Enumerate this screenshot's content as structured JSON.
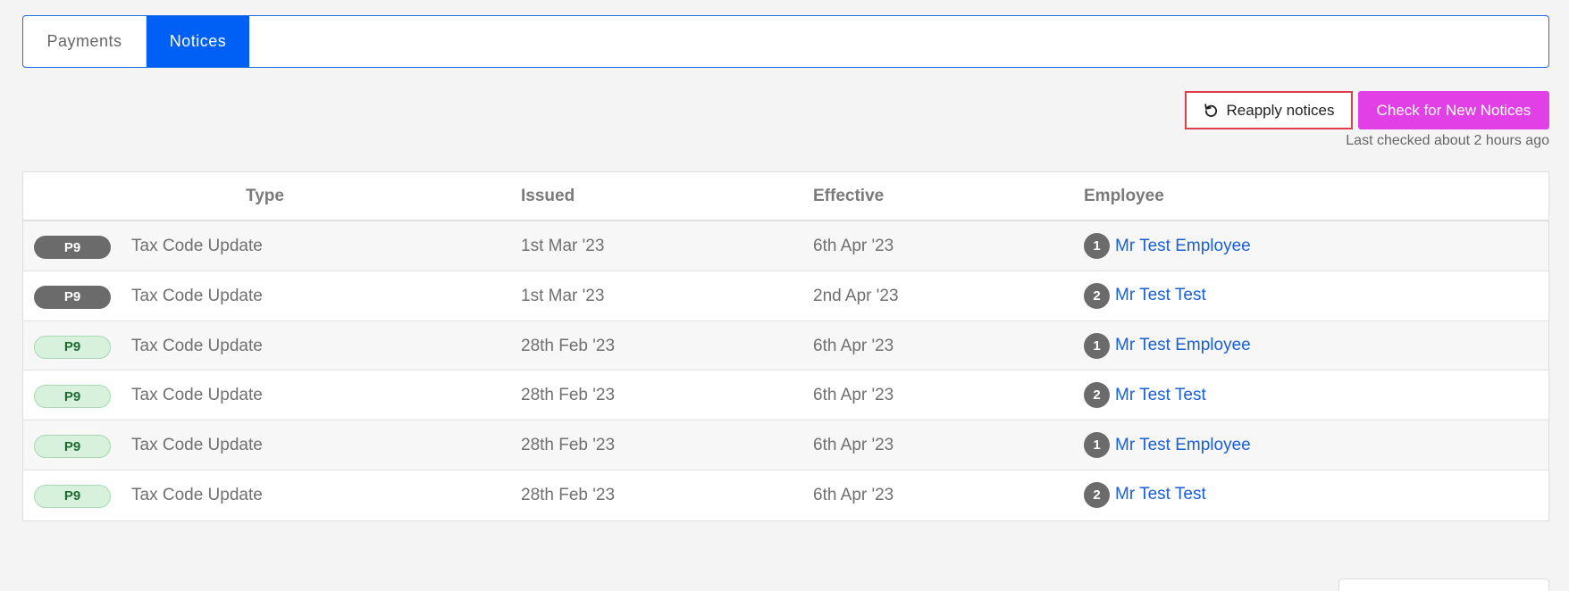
{
  "tabs": [
    {
      "label": "Payments",
      "active": false
    },
    {
      "label": "Notices",
      "active": true
    }
  ],
  "actions": {
    "reapply_label": "Reapply notices",
    "reapply_icon": "reload-icon",
    "check_label": "Check for New Notices",
    "check_color": "#e040e6",
    "last_checked": "Last checked about 2 hours ago"
  },
  "table": {
    "headers": {
      "type": "Type",
      "issued": "Issued",
      "effective": "Effective",
      "employee": "Employee"
    },
    "rows": [
      {
        "badge": "P9",
        "badge_style": "dark",
        "type": "Tax Code Update",
        "issued": "1st Mar '23",
        "effective": "6th Apr '23",
        "employee_num": "1",
        "employee": "Mr Test Employee"
      },
      {
        "badge": "P9",
        "badge_style": "dark",
        "type": "Tax Code Update",
        "issued": "1st Mar '23",
        "effective": "2nd Apr '23",
        "employee_num": "2",
        "employee": "Mr Test Test"
      },
      {
        "badge": "P9",
        "badge_style": "green",
        "type": "Tax Code Update",
        "issued": "28th Feb '23",
        "effective": "6th Apr '23",
        "employee_num": "1",
        "employee": "Mr Test Employee"
      },
      {
        "badge": "P9",
        "badge_style": "green",
        "type": "Tax Code Update",
        "issued": "28th Feb '23",
        "effective": "6th Apr '23",
        "employee_num": "2",
        "employee": "Mr Test Test"
      },
      {
        "badge": "P9",
        "badge_style": "green",
        "type": "Tax Code Update",
        "issued": "28th Feb '23",
        "effective": "6th Apr '23",
        "employee_num": "1",
        "employee": "Mr Test Employee"
      },
      {
        "badge": "P9",
        "badge_style": "green",
        "type": "Tax Code Update",
        "issued": "28th Feb '23",
        "effective": "6th Apr '23",
        "employee_num": "2",
        "employee": "Mr Test Test"
      }
    ]
  },
  "colors": {
    "accent": "#005ff5",
    "link": "#1a5fd8",
    "highlight_border": "#e03e4a"
  }
}
